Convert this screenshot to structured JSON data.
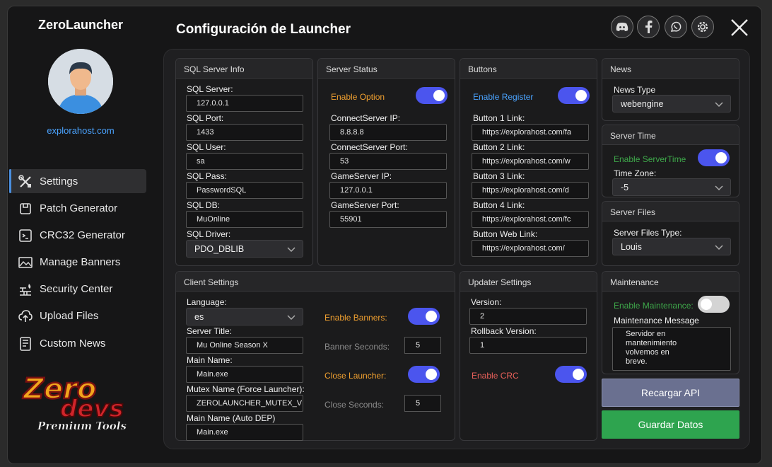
{
  "app_title": "ZeroLauncher",
  "site_link": "explorahost.com",
  "page_title": "Configuración de Launcher",
  "nav": [
    {
      "label": "Settings",
      "icon": "tools-icon"
    },
    {
      "label": "Patch Generator",
      "icon": "patch-icon"
    },
    {
      "label": "CRC32 Generator",
      "icon": "crc-icon"
    },
    {
      "label": "Manage Banners",
      "icon": "image-icon"
    },
    {
      "label": "Security Center",
      "icon": "firewall-icon"
    },
    {
      "label": "Upload Files",
      "icon": "upload-icon"
    },
    {
      "label": "Custom News",
      "icon": "news-icon"
    }
  ],
  "logo": {
    "line1": "Zero",
    "line2": "devs",
    "line3": "Premium Tools"
  },
  "sql": {
    "title": "SQL Server Info",
    "server_label": "SQL Server:",
    "server_value": "127.0.0.1",
    "port_label": "SQL Port:",
    "port_value": "1433",
    "user_label": "SQL User:",
    "user_value": "sa",
    "pass_label": "SQL Pass:",
    "pass_value": "PasswordSQL",
    "db_label": "SQL DB:",
    "db_value": "MuOnline",
    "driver_label": "SQL Driver:",
    "driver_value": "PDO_DBLIB"
  },
  "status": {
    "title": "Server Status",
    "enable_label": "Enable Option",
    "enable_on": true,
    "cs_ip_label": "ConnectServer IP:",
    "cs_ip_value": "8.8.8.8",
    "cs_port_label": "ConnectServer Port:",
    "cs_port_value": "53",
    "gs_ip_label": "GameServer IP:",
    "gs_ip_value": "127.0.0.1",
    "gs_port_label": "GameServer Port:",
    "gs_port_value": "55901"
  },
  "buttons": {
    "title": "Buttons",
    "enable_label": "Enable Register",
    "enable_on": true,
    "b1_label": "Button 1 Link:",
    "b1_value": "https://explorahost.com/fa",
    "b2_label": "Button 2 Link:",
    "b2_value": "https://explorahost.com/w",
    "b3_label": "Button 3 Link:",
    "b3_value": "https://explorahost.com/d",
    "b4_label": "Button 4 Link:",
    "b4_value": "https://explorahost.com/fc",
    "web_label": "Button Web Link:",
    "web_value": "https://explorahost.com/"
  },
  "news": {
    "title": "News",
    "type_label": "News Type",
    "type_value": "webengine"
  },
  "server_time": {
    "title": "Server Time",
    "enable_label": "Enable ServerTime",
    "enable_on": true,
    "tz_label": "Time Zone:",
    "tz_value": "-5"
  },
  "server_files": {
    "title": "Server Files",
    "type_label": "Server Files Type:",
    "type_value": "Louis"
  },
  "client": {
    "title": "Client Settings",
    "lang_label": "Language:",
    "lang_value": "es",
    "server_title_label": "Server Title:",
    "server_title_value": "Mu Online Season X",
    "main_name_label": "Main Name:",
    "main_name_value": "Main.exe",
    "mutex_label": "Mutex Name (Force Launcher):",
    "mutex_value": "ZEROLAUNCHER_MUTEX_V",
    "dep_label": "Main Name (Auto DEP)",
    "dep_value": "Main.exe",
    "banners_label": "Enable Banners:",
    "banners_on": true,
    "banner_sec_label": "Banner Seconds:",
    "banner_sec_value": "5",
    "close_label": "Close Launcher:",
    "close_on": true,
    "close_sec_label": "Close Seconds:",
    "close_sec_value": "5"
  },
  "updater": {
    "title": "Updater Settings",
    "version_label": "Version:",
    "version_value": "2",
    "rollback_label": "Rollback Version:",
    "rollback_value": "1",
    "crc_label": "Enable CRC",
    "crc_on": true
  },
  "maintenance": {
    "title": "Maintenance",
    "enable_label": "Enable Maintenance:",
    "enable_on": false,
    "msg_label": "Maintenance Message",
    "msg_value": "Servidor en mantenimiento volvemos en breve."
  },
  "actions": {
    "reload_label": "Recargar API",
    "save_label": "Guardar Datos"
  },
  "colors": {
    "accent": "#4b55ee",
    "orange": "#f0a030",
    "blue": "#4aa3ff",
    "green": "#3ea84a",
    "red": "#e8605a",
    "reload_bg": "#6a7090",
    "save_bg": "#2ea44f"
  }
}
